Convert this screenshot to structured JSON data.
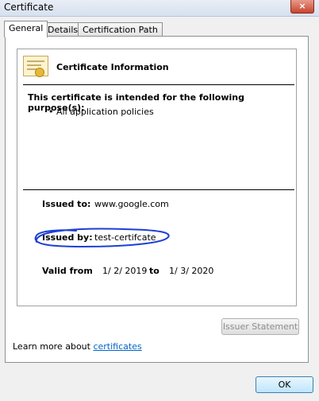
{
  "window": {
    "title": "Certificate",
    "close_symbol": "×"
  },
  "tabs": [
    {
      "label": "General",
      "active": true
    },
    {
      "label": "Details",
      "active": false
    },
    {
      "label": "Certification Path",
      "active": false
    }
  ],
  "general": {
    "heading": "Certificate Information",
    "purpose_text": "This certificate is intended for the following purpose(s):",
    "purposes": [
      "All application policies"
    ],
    "issued_to_label": "Issued to:",
    "issued_to_value": "www.google.com",
    "issued_by_label": "Issued by:",
    "issued_by_value": "test-certifcate",
    "valid_from_label": "Valid from",
    "valid_from_value": "1/ 2/ 2019",
    "valid_to_label": "to",
    "valid_to_value": "1/ 3/ 2020",
    "issuer_button": "Issuer Statement",
    "learn_prefix": "Learn more about ",
    "learn_link": "certificates"
  },
  "footer": {
    "ok_label": "OK"
  },
  "colors": {
    "ink_circle": "#1d3fd6",
    "link": "#0066cc",
    "ok_border": "#3c7fb1"
  },
  "icons": {
    "certificate": "certificate-icon",
    "close": "close-icon"
  }
}
